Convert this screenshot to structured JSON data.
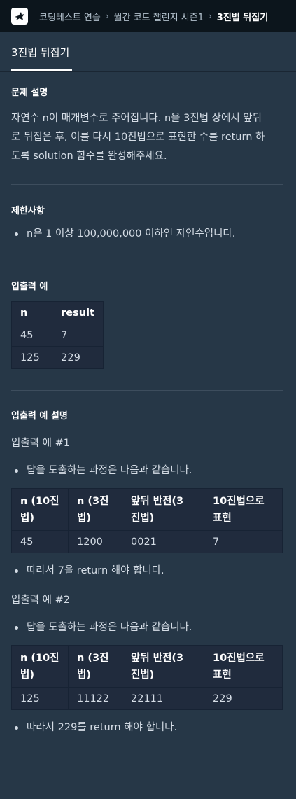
{
  "breadcrumb": {
    "items": [
      "코딩테스트 연습",
      "월간 코드 챌린지 시즌1",
      "3진법 뒤집기"
    ]
  },
  "tab": {
    "title": "3진법 뒤집기"
  },
  "description": {
    "heading": "문제 설명",
    "lines": [
      "자연수 n이 매개변수로 주어집니다. n을 3진법 상에서 앞뒤",
      "로 뒤집은 후, 이를 다시 10진법으로 표현한 수를 return 하",
      "도록 solution 함수를 완성해주세요."
    ]
  },
  "constraints": {
    "heading": "제한사항",
    "items": [
      "n은 1 이상 100,000,000 이하인 자연수입니다."
    ]
  },
  "examples": {
    "heading": "입출력 예",
    "headers": [
      "n",
      "result"
    ],
    "rows": [
      [
        "45",
        "7"
      ],
      [
        "125",
        "229"
      ]
    ]
  },
  "explanation": {
    "heading": "입출력 예 설명",
    "ex1": {
      "title": "입출력 예 #1",
      "intro": "답을 도출하는 과정은 다음과 같습니다.",
      "headers": [
        [
          "n (10진",
          "법)"
        ],
        [
          "n (3진",
          "법)"
        ],
        [
          "앞뒤 반전(3",
          "진법)"
        ],
        [
          "10진법으로",
          "표현"
        ]
      ],
      "row": [
        "45",
        "1200",
        "0021",
        "7"
      ],
      "outro": "따라서 7을 return 해야 합니다."
    },
    "ex2": {
      "title": "입출력 예 #2",
      "intro": "답을 도출하는 과정은 다음과 같습니다.",
      "headers": [
        [
          "n (10진",
          "법)"
        ],
        [
          "n (3진",
          "법)"
        ],
        [
          "앞뒤 반전(3",
          "진법)"
        ],
        [
          "10진법으로",
          "표현"
        ]
      ],
      "row": [
        "125",
        "11122",
        "22111",
        "229"
      ],
      "outro": "따라서 229를 return 해야 합니다."
    }
  },
  "colors": {
    "topbar": "#0c151c",
    "background": "#263747",
    "table": "#202b3d"
  }
}
